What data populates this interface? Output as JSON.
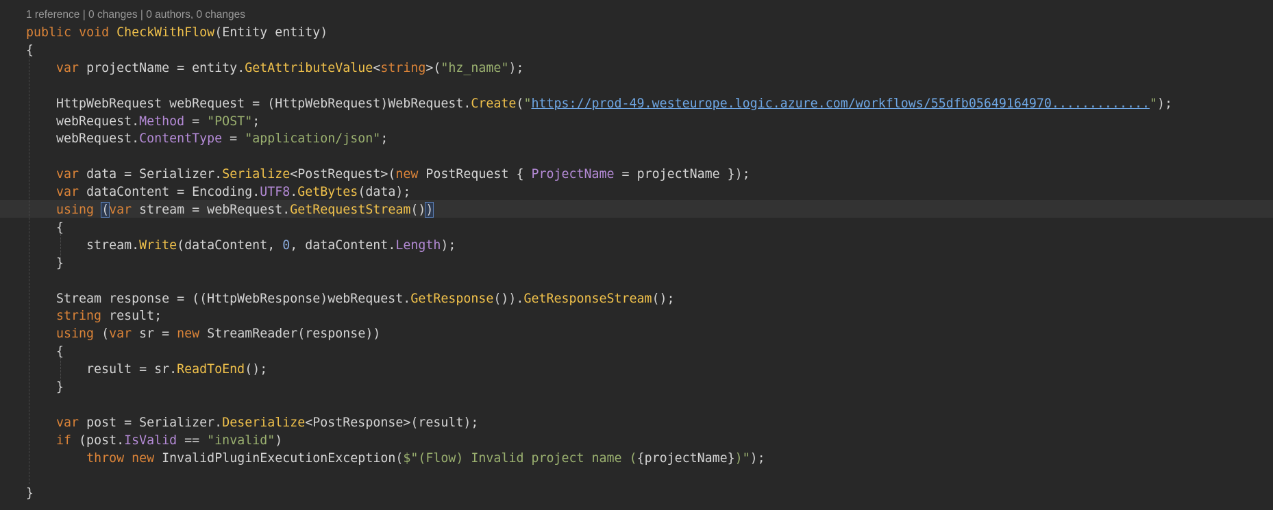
{
  "codelens": "1 reference | 0 changes | 0 authors, 0 changes",
  "lines": [
    {
      "tokens": [
        {
          "t": "public",
          "c": "kw"
        },
        {
          "t": " "
        },
        {
          "t": "void",
          "c": "kw"
        },
        {
          "t": " "
        },
        {
          "t": "CheckWithFlow",
          "c": "mth"
        },
        {
          "t": "(Entity entity)"
        }
      ]
    },
    {
      "tokens": [
        {
          "t": "{"
        }
      ]
    },
    {
      "tokens": [
        {
          "t": "    "
        },
        {
          "t": "var",
          "c": "kw"
        },
        {
          "t": " projectName = entity."
        },
        {
          "t": "GetAttributeValue",
          "c": "mth"
        },
        {
          "t": "<"
        },
        {
          "t": "string",
          "c": "kw"
        },
        {
          "t": ">("
        },
        {
          "t": "\"hz_name\"",
          "c": "str"
        },
        {
          "t": ");"
        }
      ]
    },
    {
      "tokens": []
    },
    {
      "tokens": [
        {
          "t": "    HttpWebRequest webRequest = (HttpWebRequest)WebRequest."
        },
        {
          "t": "Create",
          "c": "mth"
        },
        {
          "t": "("
        },
        {
          "t": "\"",
          "c": "str"
        },
        {
          "t": "https://prod-49.westeurope.logic.azure.com/workflows/55dfb05649164970.............",
          "c": "link"
        },
        {
          "t": "\"",
          "c": "str"
        },
        {
          "t": ");"
        }
      ]
    },
    {
      "tokens": [
        {
          "t": "    webRequest."
        },
        {
          "t": "Method",
          "c": "prop"
        },
        {
          "t": " = "
        },
        {
          "t": "\"POST\"",
          "c": "str"
        },
        {
          "t": ";"
        }
      ]
    },
    {
      "tokens": [
        {
          "t": "    webRequest."
        },
        {
          "t": "ContentType",
          "c": "prop"
        },
        {
          "t": " = "
        },
        {
          "t": "\"application/json\"",
          "c": "str"
        },
        {
          "t": ";"
        }
      ]
    },
    {
      "tokens": []
    },
    {
      "tokens": [
        {
          "t": "    "
        },
        {
          "t": "var",
          "c": "kw"
        },
        {
          "t": " data = Serializer."
        },
        {
          "t": "Serialize",
          "c": "mth"
        },
        {
          "t": "<PostRequest>("
        },
        {
          "t": "new",
          "c": "kw"
        },
        {
          "t": " PostRequest { "
        },
        {
          "t": "ProjectName",
          "c": "prop"
        },
        {
          "t": " = projectName });"
        }
      ]
    },
    {
      "tokens": [
        {
          "t": "    "
        },
        {
          "t": "var",
          "c": "kw"
        },
        {
          "t": " dataContent = Encoding."
        },
        {
          "t": "UTF8",
          "c": "prop"
        },
        {
          "t": "."
        },
        {
          "t": "GetBytes",
          "c": "mth"
        },
        {
          "t": "(data);"
        }
      ]
    },
    {
      "tokens": [
        {
          "t": "    "
        },
        {
          "t": "using",
          "c": "kw"
        },
        {
          "t": " "
        },
        {
          "t": "(",
          "c": "paren-match"
        },
        {
          "t": "var",
          "c": "kw"
        },
        {
          "t": " stream = webRequest."
        },
        {
          "t": "GetRequestStream",
          "c": "mth"
        },
        {
          "t": "()"
        },
        {
          "t": ")",
          "c": "paren-match"
        }
      ]
    },
    {
      "tokens": [
        {
          "t": "    {"
        }
      ]
    },
    {
      "tokens": [
        {
          "t": "        stream."
        },
        {
          "t": "Write",
          "c": "mth"
        },
        {
          "t": "(dataContent, "
        },
        {
          "t": "0",
          "c": "num"
        },
        {
          "t": ", dataContent."
        },
        {
          "t": "Length",
          "c": "prop"
        },
        {
          "t": ");"
        }
      ]
    },
    {
      "tokens": [
        {
          "t": "    }"
        }
      ]
    },
    {
      "tokens": []
    },
    {
      "tokens": [
        {
          "t": "    Stream response = ((HttpWebResponse)webRequest."
        },
        {
          "t": "GetResponse",
          "c": "mth"
        },
        {
          "t": "())."
        },
        {
          "t": "GetResponseStream",
          "c": "mth"
        },
        {
          "t": "();"
        }
      ]
    },
    {
      "tokens": [
        {
          "t": "    "
        },
        {
          "t": "string",
          "c": "kw"
        },
        {
          "t": " result;"
        }
      ]
    },
    {
      "tokens": [
        {
          "t": "    "
        },
        {
          "t": "using",
          "c": "kw"
        },
        {
          "t": " ("
        },
        {
          "t": "var",
          "c": "kw"
        },
        {
          "t": " sr = "
        },
        {
          "t": "new",
          "c": "kw"
        },
        {
          "t": " StreamReader(response))"
        }
      ]
    },
    {
      "tokens": [
        {
          "t": "    {"
        }
      ]
    },
    {
      "tokens": [
        {
          "t": "        result = sr."
        },
        {
          "t": "ReadToEnd",
          "c": "mth"
        },
        {
          "t": "();"
        }
      ]
    },
    {
      "tokens": [
        {
          "t": "    }"
        }
      ]
    },
    {
      "tokens": []
    },
    {
      "tokens": [
        {
          "t": "    "
        },
        {
          "t": "var",
          "c": "kw"
        },
        {
          "t": " post = Serializer."
        },
        {
          "t": "Deserialize",
          "c": "mth"
        },
        {
          "t": "<PostResponse>(result);"
        }
      ]
    },
    {
      "tokens": [
        {
          "t": "    "
        },
        {
          "t": "if",
          "c": "kw"
        },
        {
          "t": " (post."
        },
        {
          "t": "IsValid",
          "c": "prop"
        },
        {
          "t": " == "
        },
        {
          "t": "\"invalid\"",
          "c": "str"
        },
        {
          "t": ")"
        }
      ]
    },
    {
      "tokens": [
        {
          "t": "        "
        },
        {
          "t": "throw",
          "c": "kw"
        },
        {
          "t": " "
        },
        {
          "t": "new",
          "c": "kw"
        },
        {
          "t": " InvalidPluginExecutionException("
        },
        {
          "t": "$\"(Flow) Invalid project name (",
          "c": "str"
        },
        {
          "t": "{projectName}"
        },
        {
          "t": ")\"",
          "c": "str"
        },
        {
          "t": ");"
        }
      ]
    },
    {
      "tokens": []
    },
    {
      "tokens": [
        {
          "t": "}"
        }
      ]
    }
  ]
}
